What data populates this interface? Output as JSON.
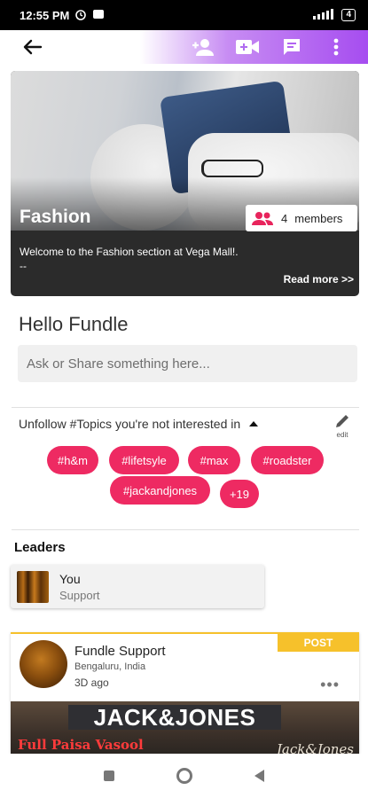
{
  "status_bar": {
    "time": "12:55 PM",
    "battery": "4"
  },
  "group": {
    "title": "Fashion",
    "members_count": "4",
    "members_label": "members",
    "description": "Welcome to the Fashion section at Vega Mall!.",
    "description_more": "--",
    "read_more": "Read more >>"
  },
  "greeting": "Hello Fundle",
  "compose": {
    "placeholder": "Ask or Share something here..."
  },
  "topics": {
    "header": "Unfollow #Topics you're not interested in",
    "edit_label": "edit",
    "tags": [
      "#h&m",
      "#lifetsyle",
      "#max",
      "#roadster",
      "#jackandjones"
    ],
    "more": "+19"
  },
  "leaders": {
    "title": "Leaders",
    "items": [
      {
        "name": "You",
        "role": "Support"
      }
    ]
  },
  "post": {
    "badge": "POST",
    "author": "Fundle Support",
    "location": "Bengaluru, India",
    "time": "3D ago",
    "menu": "•••",
    "image_sign": "JACK&JONES",
    "image_text_left": "Full Paisa Vasool",
    "image_text_right": "Jack&Jones"
  },
  "colors": {
    "accent_purple": "#a64df0",
    "tag_pink": "#ee2a62",
    "post_yellow": "#f6c12b"
  }
}
